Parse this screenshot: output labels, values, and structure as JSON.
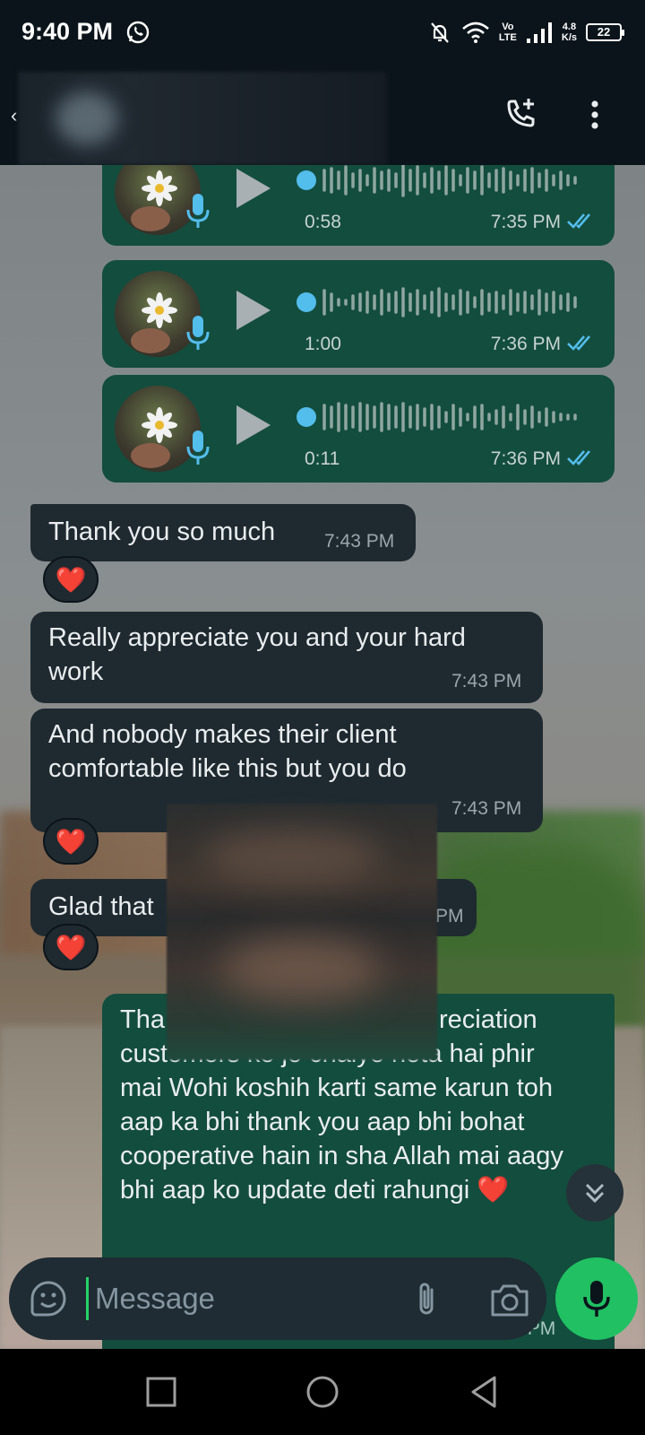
{
  "status_bar": {
    "time": "9:40 PM",
    "network_speed_top": "4.8",
    "network_speed_bottom": "K/s",
    "volte_top": "Vo",
    "volte_bottom": "LTE",
    "battery": "22"
  },
  "header": {
    "icons": [
      "back-arrow-icon",
      "add-call-icon",
      "more-vert-icon"
    ]
  },
  "messages": [
    {
      "type": "voice",
      "direction": "outgoing",
      "duration": "0:58",
      "time": "7:35 PM",
      "status": "read"
    },
    {
      "type": "voice",
      "direction": "outgoing",
      "duration": "1:00",
      "time": "7:36 PM",
      "status": "read"
    },
    {
      "type": "voice",
      "direction": "outgoing",
      "duration": "0:11",
      "time": "7:36 PM",
      "status": "read"
    },
    {
      "type": "text",
      "direction": "incoming",
      "text": "Thank you so much",
      "time": "7:43 PM",
      "reaction": "❤️"
    },
    {
      "type": "text",
      "direction": "incoming",
      "text": "Really appreciate you and your hard work",
      "time": "7:43 PM"
    },
    {
      "type": "text",
      "direction": "incoming",
      "text": "And nobody makes their client comfortable like this but you do",
      "time": "7:43 PM",
      "reaction": "❤️"
    },
    {
      "type": "text",
      "direction": "incoming",
      "text": "Glad that",
      "time_partial": "PM",
      "reaction": "❤️"
    },
    {
      "type": "text",
      "direction": "outgoing",
      "text_line1_left": "Tha",
      "text_line1_right": "reciation",
      "text_line2": "customers ko jo chaiye hota hai phir",
      "text_rest": "mai Wohi koshih karti same karun toh aap ka bhi thank you aap bhi bohat cooperative hain in sha Allah mai aagy bhi aap ko update deti rahungi ❤️",
      "time_partial": "7:47 PM"
    }
  ],
  "input": {
    "placeholder": "Message"
  },
  "colors": {
    "outgoing_bubble": "#134d3e",
    "incoming_bubble": "#1f2a30",
    "accent": "#21c063",
    "read_ticks": "#53bdeb",
    "voice_dot": "#53bdeb"
  }
}
